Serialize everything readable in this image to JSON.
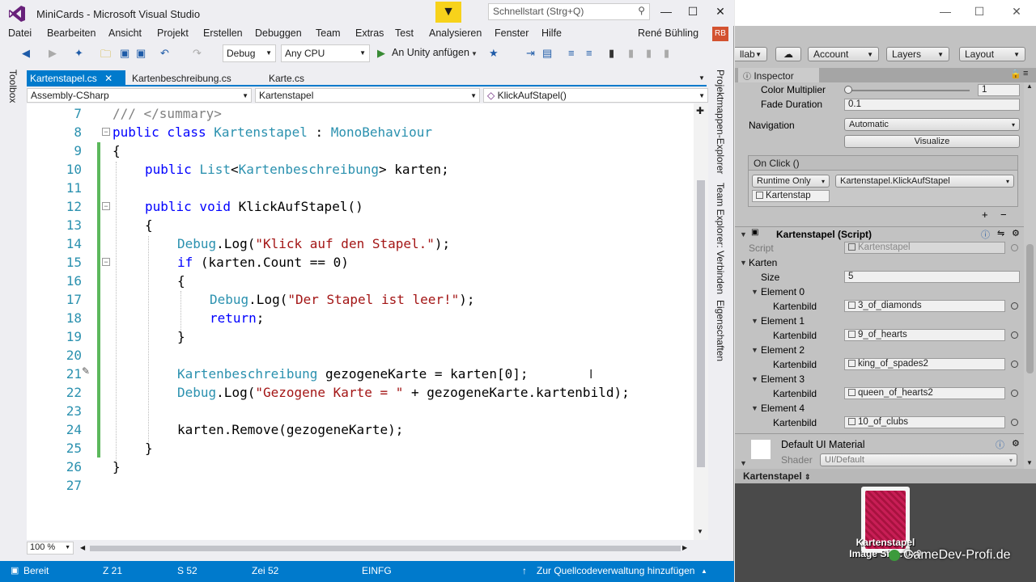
{
  "vs": {
    "title": "MiniCards - Microsoft Visual Studio",
    "quick_launch_placeholder": "Schnellstart (Strg+Q)",
    "menu": [
      "Datei",
      "Bearbeiten",
      "Ansicht",
      "Projekt",
      "Erstellen",
      "Debuggen",
      "Team",
      "Extras",
      "Test",
      "Analysieren",
      "Fenster",
      "Hilfe"
    ],
    "user": {
      "name": "René Bühling",
      "initials": "RB"
    },
    "toolbar": {
      "config": "Debug",
      "platform": "Any CPU",
      "attach": "An Unity anfügen"
    },
    "left_panel": "Toolbox",
    "right_panels": [
      "Projektmappen-Explorer",
      "Team Explorer: Verbinden",
      "Eigenschaften"
    ],
    "tabs": [
      {
        "label": "Kartenstapel.cs",
        "active": true
      },
      {
        "label": "Kartenbeschreibung.cs",
        "active": false
      },
      {
        "label": "Karte.cs",
        "active": false
      }
    ],
    "nav": {
      "project": "Assembly-CSharp",
      "type": "Kartenstapel",
      "member": "KlickAufStapel()"
    },
    "line_numbers": [
      "7",
      "8",
      "9",
      "10",
      "11",
      "12",
      "13",
      "14",
      "15",
      "16",
      "17",
      "18",
      "19",
      "20",
      "21",
      "22",
      "23",
      "24",
      "25",
      "26",
      "27"
    ],
    "code": {
      "l7": "/// </summary>",
      "l8_kw": "public class ",
      "l8_cls": "Kartenstapel",
      "l8_mid": " : ",
      "l8_base": "MonoBehaviour",
      "l9": "{",
      "l10_kw": "public ",
      "l10_ty1": "List",
      "l10_a": "<",
      "l10_ty2": "Kartenbeschreibung",
      "l10_b": "> karten;",
      "l12_kw": "public void ",
      "l12_rest": "KlickAufStapel()",
      "l13": "{",
      "l14_ty": "Debug",
      "l14_a": ".Log(",
      "l14_str": "\"Klick auf den Stapel.\"",
      "l14_b": ");",
      "l15_kw": "if ",
      "l15_rest": "(karten.Count == 0)",
      "l16": "{",
      "l17_ty": "Debug",
      "l17_a": ".Log(",
      "l17_str": "\"Der Stapel ist leer!\"",
      "l17_b": ");",
      "l18_kw": "return",
      "l18_b": ";",
      "l19": "}",
      "l21_ty": "Kartenbeschreibung",
      "l21_rest": " gezogeneKarte = karten[0];",
      "l22_ty": "Debug",
      "l22_a": ".Log(",
      "l22_str": "\"Gezogene Karte = \"",
      "l22_b": " + gezogeneKarte.kartenbild);",
      "l24": "karten.Remove(gezogeneKarte);",
      "l25": "}",
      "l26": "}"
    },
    "zoom": "100 %",
    "status": {
      "ready": "Bereit",
      "line": "Z 21",
      "col": "S 52",
      "char": "Zei 52",
      "mode": "EINFG",
      "source_control": "Zur Quellcodeverwaltung hinzufügen"
    }
  },
  "unity": {
    "toolbar": {
      "collab": "llab",
      "account": "Account",
      "layers": "Layers",
      "layout": "Layout"
    },
    "inspector_tab": "Inspector",
    "button_component": {
      "color_multiplier_label": "Color Multiplier",
      "color_multiplier_value": "1",
      "fade_duration_label": "Fade Duration",
      "fade_duration_value": "0.1",
      "navigation_label": "Navigation",
      "navigation_value": "Automatic",
      "visualize": "Visualize",
      "onclick_header": "On Click ()",
      "runtime": "Runtime Only",
      "function": "Kartenstapel.KlickAufStapel",
      "target_object": "Kartenstap"
    },
    "script_component": {
      "title": "Kartenstapel (Script)",
      "script_label": "Script",
      "script_value": "Kartenstapel",
      "karten_label": "Karten",
      "size_label": "Size",
      "size_value": "5",
      "kartenbild_label": "Kartenbild",
      "elements": [
        {
          "label": "Element 0",
          "value": "3_of_diamonds"
        },
        {
          "label": "Element 1",
          "value": "9_of_hearts"
        },
        {
          "label": "Element 2",
          "value": "king_of_spades2"
        },
        {
          "label": "Element 3",
          "value": "queen_of_hearts2"
        },
        {
          "label": "Element 4",
          "value": "10_of_clubs"
        }
      ]
    },
    "material": {
      "name": "Default UI Material",
      "shader_label": "Shader",
      "shader_value": "UI/Default"
    },
    "preview": {
      "header": "Kartenstapel",
      "caption1": "Kartenstapel",
      "caption2": "Image Size: 0x0",
      "watermark": "GameDev-Profi.de"
    }
  }
}
